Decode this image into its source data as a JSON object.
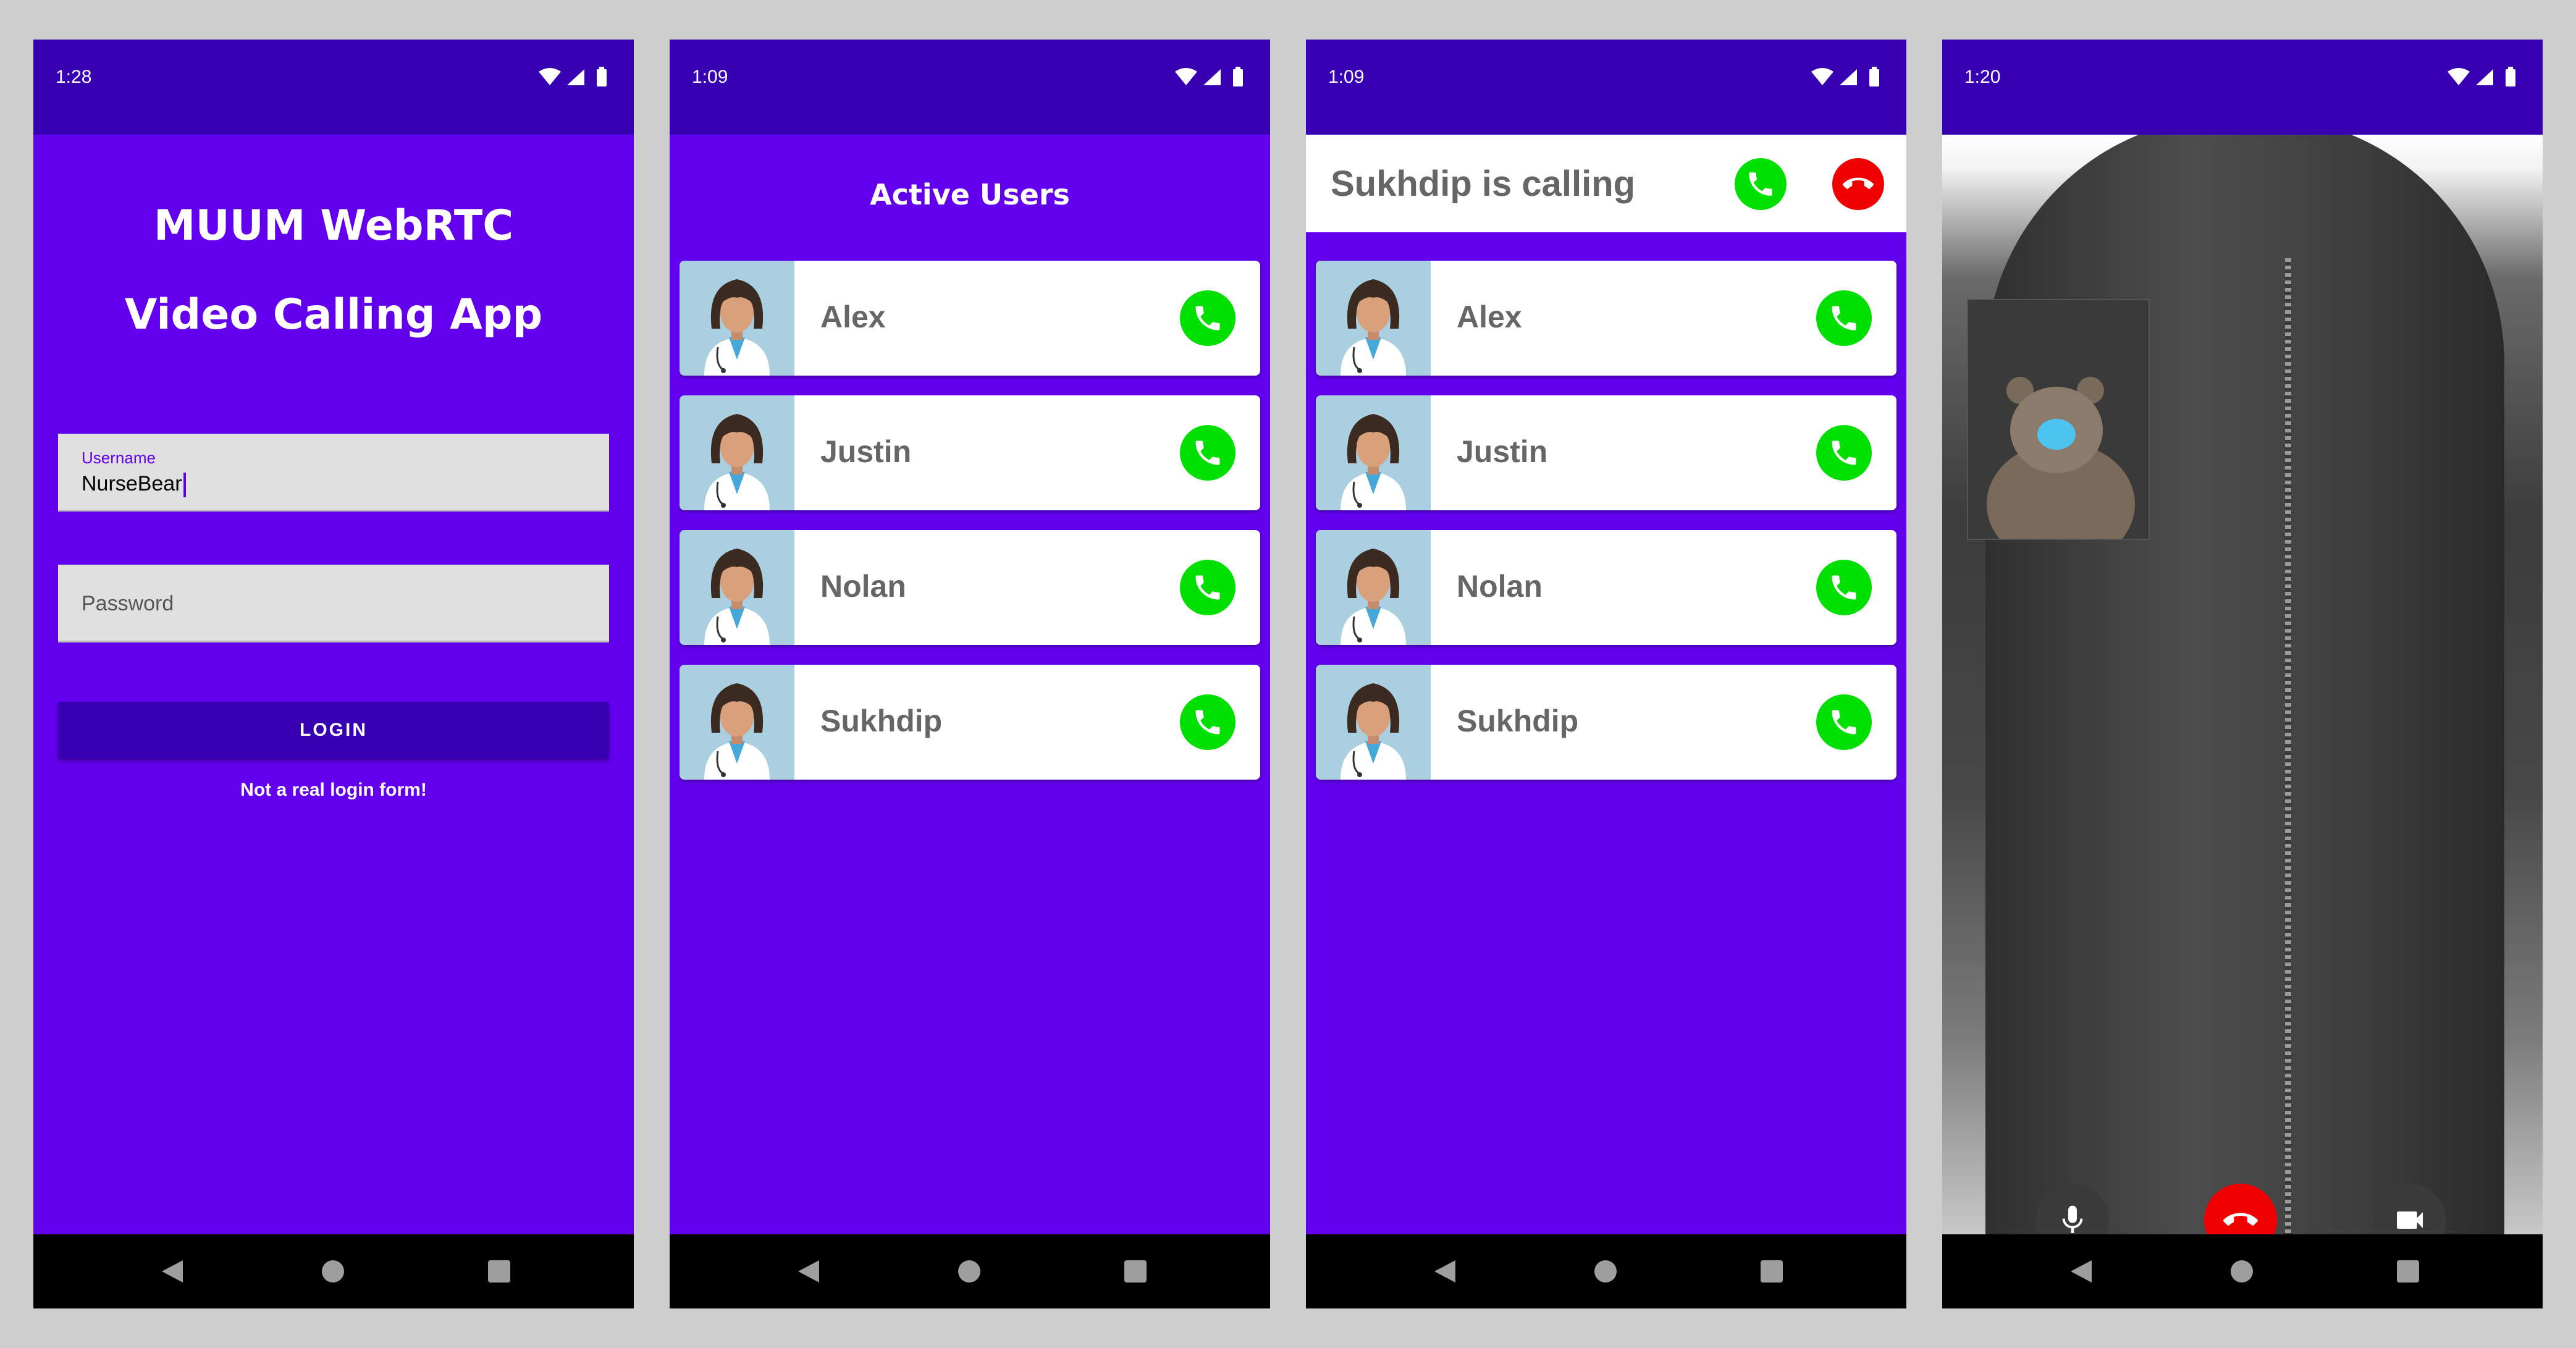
{
  "screens": {
    "login": {
      "time": "1:28",
      "title_line1": "MUUM WebRTC",
      "title_line2": "Video Calling App",
      "username_label": "Username",
      "username_value": "NurseBear",
      "password_placeholder": "Password",
      "login_button": "LOGIN",
      "note": "Not a real login form!"
    },
    "active_users": {
      "time": "1:09",
      "title": "Active Users",
      "users": [
        "Alex",
        "Justin",
        "Nolan",
        "Sukhdip"
      ]
    },
    "incoming_call": {
      "time": "1:09",
      "banner": "Sukhdip is calling",
      "users": [
        "Alex",
        "Justin",
        "Nolan",
        "Sukhdip"
      ]
    },
    "video_call": {
      "time": "1:20"
    }
  },
  "colors": {
    "primary": "#6200ee",
    "primary_dark": "#3700b3",
    "call_green": "#00e000",
    "hangup_red": "#f00000",
    "avatar_bg": "#a9cfe0"
  },
  "icons": {
    "status": [
      "wifi-icon",
      "signal-icon",
      "battery-icon"
    ],
    "call": "phone-icon",
    "hangup": "hangup-icon",
    "mic": "microphone-icon",
    "camera": "video-camera-icon",
    "nav": [
      "back-icon",
      "home-icon",
      "recents-icon"
    ]
  }
}
